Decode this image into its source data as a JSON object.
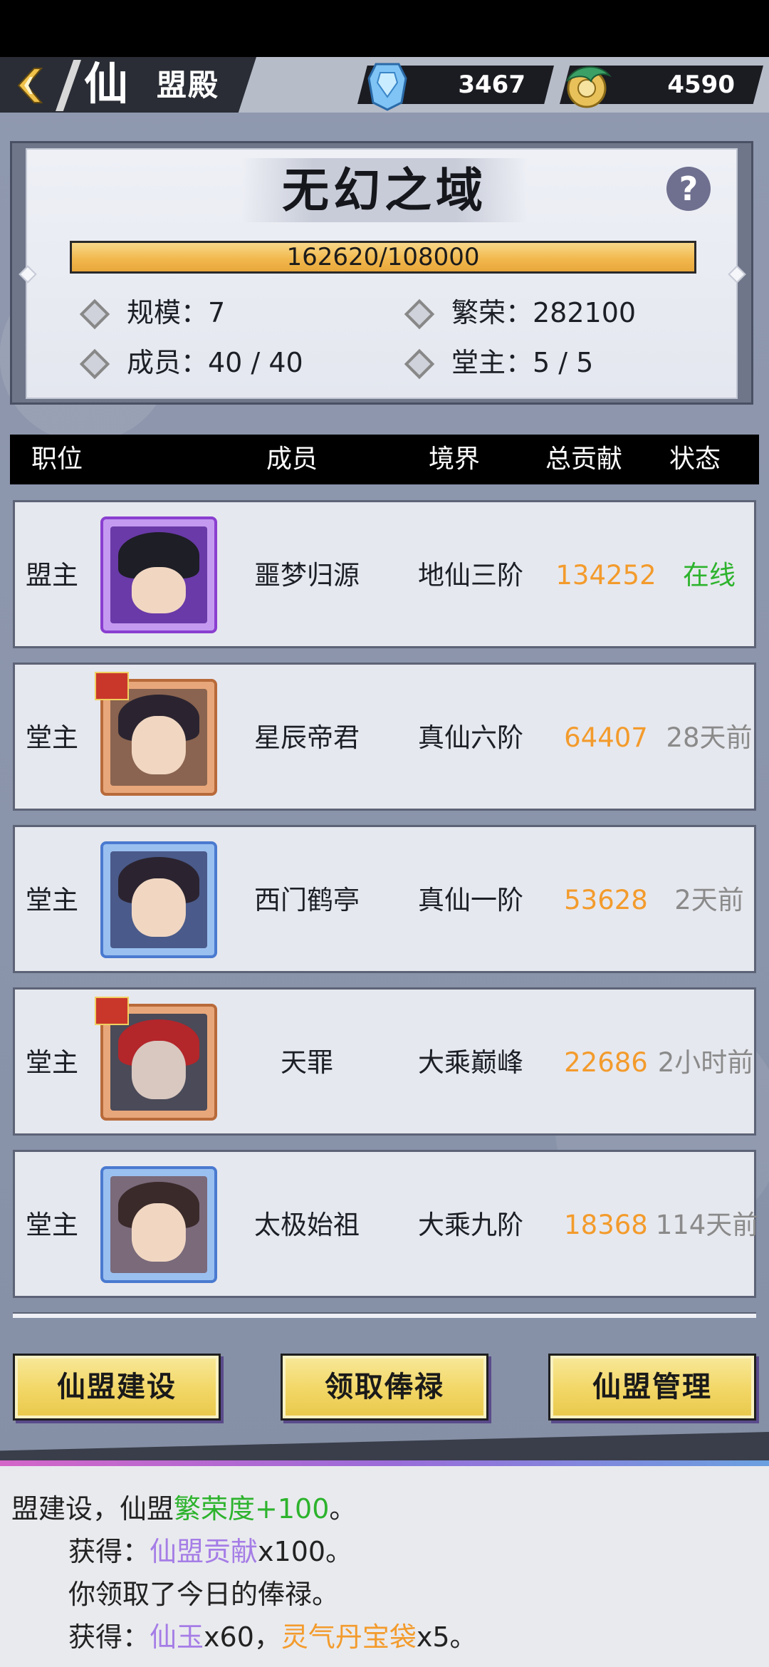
{
  "header": {
    "title_big": "仙",
    "title_small": "盟殿",
    "currency_1": "3467",
    "currency_2": "4590"
  },
  "guild": {
    "name": "无幻之域",
    "progress_text": "162620/108000",
    "scale_label": "规模：7",
    "prosperity_label": "繁荣：282100",
    "members_label": "成员：40 / 40",
    "halls_label": "堂主：5 / 5"
  },
  "table": {
    "headers": [
      "职位",
      "成员",
      "境界",
      "总贡献",
      "状态"
    ],
    "rows": [
      {
        "position": "盟主",
        "name": "噩梦归源",
        "realm": "地仙三阶",
        "contribution": "134252",
        "status": "在线"
      },
      {
        "position": "堂主",
        "name": "星辰帝君",
        "realm": "真仙六阶",
        "contribution": "64407",
        "status": "28天前"
      },
      {
        "position": "堂主",
        "name": "西门鹤亭",
        "realm": "真仙一阶",
        "contribution": "53628",
        "status": "2天前"
      },
      {
        "position": "堂主",
        "name": "天罪",
        "realm": "大乘巅峰",
        "contribution": "22686",
        "status": "2小时前"
      },
      {
        "position": "堂主",
        "name": "太极始祖",
        "realm": "大乘九阶",
        "contribution": "18368",
        "status": "114天前"
      }
    ]
  },
  "buttons": {
    "build": "仙盟建设",
    "salary": "领取俸禄",
    "manage": "仙盟管理"
  },
  "log": {
    "line1_a": "盟建设，仙盟",
    "line1_b": "繁荣度+100",
    "line1_c": "。",
    "line2_a": "获得：",
    "line2_b": "仙盟贡献",
    "line2_c": "x100。",
    "line3": "你领取了今日的俸禄。",
    "line4_a": "获得：",
    "line4_b": "仙玉",
    "line4_c": "x60，",
    "line4_d": "灵气丹宝袋",
    "line4_e": "x5。"
  },
  "colors": {
    "online": "#2db32d",
    "offline": "#8a8a8a",
    "contribution": "#f39b2c",
    "button": "#f2d665"
  },
  "icons": {
    "back": "back-chevron-icon",
    "currency_1": "jade-token-icon",
    "currency_2": "dragon-coin-icon",
    "help": "question-icon"
  }
}
